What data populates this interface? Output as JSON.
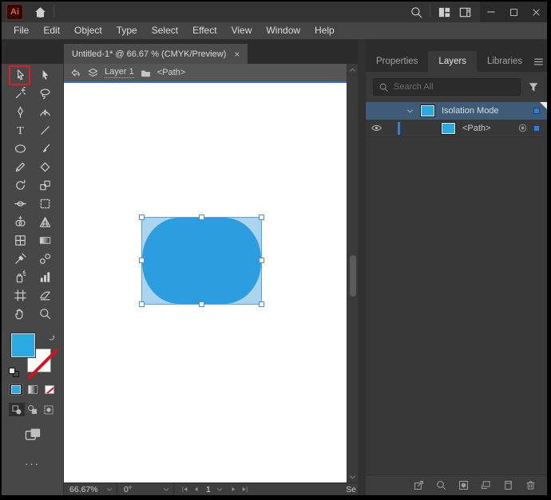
{
  "titlebar": {
    "app_badge": "Ai"
  },
  "menubar": {
    "items": [
      "File",
      "Edit",
      "Object",
      "Type",
      "Select",
      "Effect",
      "View",
      "Window",
      "Help"
    ]
  },
  "document_tab": {
    "title": "Untitled-1* @ 66.67 % (CMYK/Preview)",
    "close_glyph": "×"
  },
  "breadcrumb": {
    "layer_label": "Layer 1",
    "path_label": "<Path>"
  },
  "toolbar": {
    "selected_tool": "selection",
    "tool_rows": [
      [
        "selection",
        "direct-selection"
      ],
      [
        "magic-wand",
        "lasso"
      ],
      [
        "pen",
        "curvature"
      ],
      [
        "type",
        "line-segment"
      ],
      [
        "ellipse",
        "paintbrush"
      ],
      [
        "shaper",
        "eraser"
      ],
      [
        "rotate",
        "scale"
      ],
      [
        "width",
        "free-transform"
      ],
      [
        "shape-builder",
        "perspective-grid"
      ],
      [
        "mesh",
        "gradient"
      ],
      [
        "eyedropper",
        "blend"
      ],
      [
        "symbol-sprayer",
        "column-graph"
      ],
      [
        "artboard",
        "slice"
      ],
      [
        "hand",
        "zoom"
      ]
    ],
    "fill_color": "#29abe2",
    "stroke_style": "none",
    "more_label": "···"
  },
  "canvas": {
    "shape": {
      "fill_color": "#2c9ddf",
      "corner_color": "#abd5ee",
      "outline_color": "#5b9fe0",
      "handle_border": "#4a90d8"
    }
  },
  "layers_panel": {
    "tabs": [
      "Properties",
      "Layers",
      "Libraries"
    ],
    "active_tab": "Layers",
    "search_placeholder": "Search All",
    "rows": [
      {
        "label": "Isolation Mode"
      },
      {
        "label": "<Path>"
      }
    ],
    "accent_color": "#29abe2"
  },
  "statusbar": {
    "zoom_value": "66.67%",
    "rotation_value": "0°",
    "page_value": "1",
    "right_label": "Se"
  }
}
